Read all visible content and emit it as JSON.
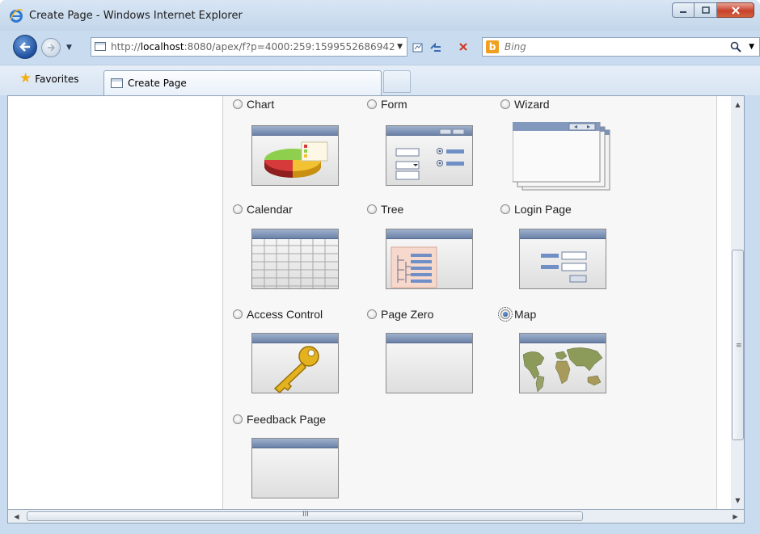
{
  "window": {
    "title": "Create Page - Windows Internet Explorer"
  },
  "navigation": {
    "address": {
      "prefix": "http://",
      "host": "localhost",
      "rest": ":8080/apex/f?p=4000:259:1599552686942"
    },
    "search": {
      "placeholder": "Bing"
    }
  },
  "favorites_bar": {
    "favorites_label": "Favorites",
    "active_tab_label": "Create Page"
  },
  "page_types": [
    {
      "id": "chart",
      "label": "Chart",
      "checked": false
    },
    {
      "id": "form",
      "label": "Form",
      "checked": false
    },
    {
      "id": "wizard",
      "label": "Wizard",
      "checked": false
    },
    {
      "id": "calendar",
      "label": "Calendar",
      "checked": false
    },
    {
      "id": "tree",
      "label": "Tree",
      "checked": false
    },
    {
      "id": "login-page",
      "label": "Login Page",
      "checked": false
    },
    {
      "id": "access-control",
      "label": "Access Control",
      "checked": false
    },
    {
      "id": "page-zero",
      "label": "Page Zero",
      "checked": false
    },
    {
      "id": "map",
      "label": "Map",
      "checked": true
    },
    {
      "id": "feedback-page",
      "label": "Feedback Page",
      "checked": false
    }
  ],
  "scrollbars": {
    "horizontal_grip": "III",
    "vertical_grip": "≡"
  },
  "colors": {
    "accent_blue": "#6b82a8",
    "chrome": "#c9dcef"
  }
}
